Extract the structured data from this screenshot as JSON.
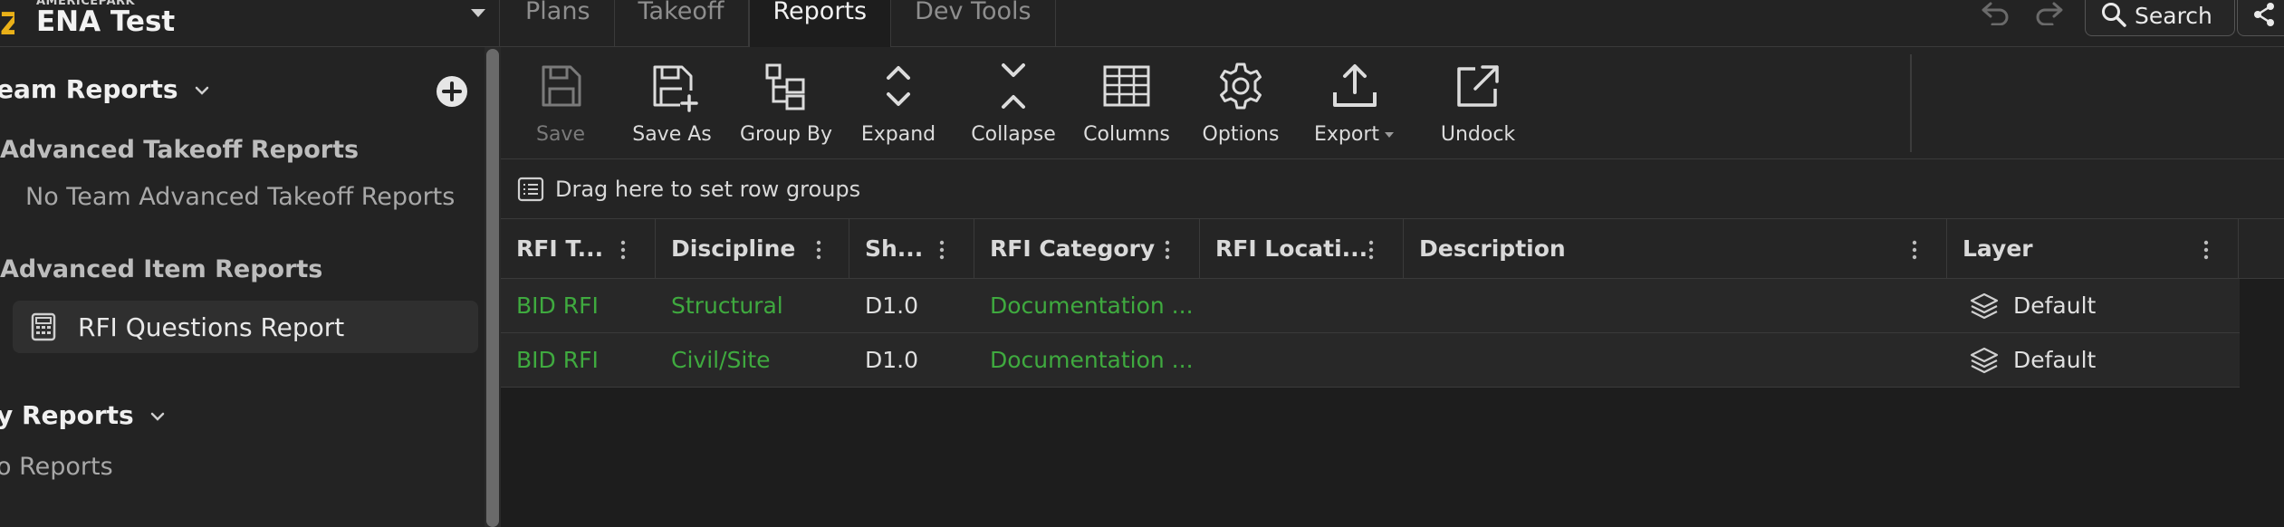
{
  "header": {
    "org": "AMERICEPARK",
    "project": "ENA Test",
    "tabs": [
      {
        "label": "Plans"
      },
      {
        "label": "Takeoff"
      },
      {
        "label": "Reports"
      },
      {
        "label": "Dev Tools"
      }
    ],
    "search_label": "Search"
  },
  "sidebar": {
    "team_reports_title": "eam Reports",
    "adv_takeoff_title": "Advanced Takeoff Reports",
    "adv_takeoff_empty": "No Team Advanced Takeoff Reports",
    "adv_item_title": "Advanced Item Reports",
    "selected_report": "RFI Questions Report",
    "my_reports_title": "y Reports",
    "my_reports_empty": "o Reports"
  },
  "toolbar": {
    "save": "Save",
    "save_as": "Save As",
    "group_by": "Group By",
    "expand": "Expand",
    "collapse": "Collapse",
    "columns": "Columns",
    "options": "Options",
    "export": "Export",
    "undock": "Undock"
  },
  "groupbar": {
    "label": "Drag here to set row groups"
  },
  "grid": {
    "columns": [
      "RFI T...",
      "Discipline",
      "Sh...",
      "RFI Category",
      "RFI Locati...",
      "Description",
      "Layer"
    ],
    "rows": [
      {
        "rfi_type": "BID RFI",
        "discipline": "Structural",
        "sheet": "D1.0",
        "category": "Documentation ...",
        "location": "",
        "description": "",
        "layer": "Default"
      },
      {
        "rfi_type": "BID RFI",
        "discipline": "Civil/Site",
        "sheet": "D1.0",
        "category": "Documentation ...",
        "location": "",
        "description": "",
        "layer": "Default"
      }
    ]
  },
  "colors": {
    "link_green": "#3faa3f",
    "accent_yellow": "#e9b018",
    "background": "#1d1d1d"
  }
}
